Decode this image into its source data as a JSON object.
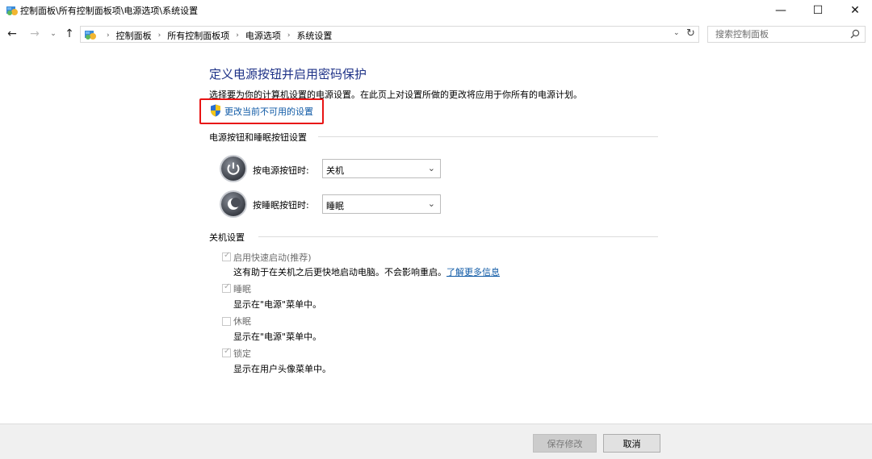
{
  "window": {
    "title": "控制面板\\所有控制面板项\\电源选项\\系统设置",
    "minimize_glyph": "—",
    "maximize_glyph": "☐",
    "close_glyph": "✕"
  },
  "nav": {
    "back_glyph": "←",
    "forward_glyph": "→",
    "recent_glyph": "⌄",
    "up_glyph": "↑",
    "refresh_glyph": "↻",
    "dropdown_glyph": "⌄"
  },
  "breadcrumb": {
    "separator": "›",
    "items": [
      "控制面板",
      "所有控制面板项",
      "电源选项",
      "系统设置"
    ]
  },
  "search": {
    "placeholder": "搜索控制面板",
    "value": ""
  },
  "main": {
    "title": "定义电源按钮并启用密码保护",
    "description": "选择要为你的计算机设置的电源设置。在此页上对设置所做的更改将应用于你所有的电源计划。",
    "change_link": "更改当前不可用的设置"
  },
  "power_buttons": {
    "heading": "电源按钮和睡眠按钮设置",
    "power_label": "按电源按钮时:",
    "power_value": "关机",
    "sleep_label": "按睡眠按钮时:",
    "sleep_value": "睡眠",
    "chevron": "⌄"
  },
  "shutdown": {
    "heading": "关机设置",
    "checkmark": "✓",
    "fast_startup": {
      "label": "启用快速启动(推荐)",
      "desc": "这有助于在关机之后更快地启动电脑。不会影响重启。",
      "link": "了解更多信息",
      "checked": true
    },
    "sleep": {
      "label": "睡眠",
      "desc": "显示在\"电源\"菜单中。",
      "checked": true
    },
    "hibernate": {
      "label": "休眠",
      "desc": "显示在\"电源\"菜单中。",
      "checked": false
    },
    "lock": {
      "label": "锁定",
      "desc": "显示在用户头像菜单中。",
      "checked": true
    }
  },
  "footer": {
    "save_label": "保存修改",
    "cancel_label": "取消"
  },
  "colors": {
    "title_blue": "#1e3287",
    "link_blue": "#0f5aa6",
    "highlight_red": "#e81414"
  },
  "icons": {
    "app": "control-panel-icon",
    "shield": "uac-shield-icon",
    "power": "power-button-icon",
    "sleep": "sleep-button-icon"
  }
}
